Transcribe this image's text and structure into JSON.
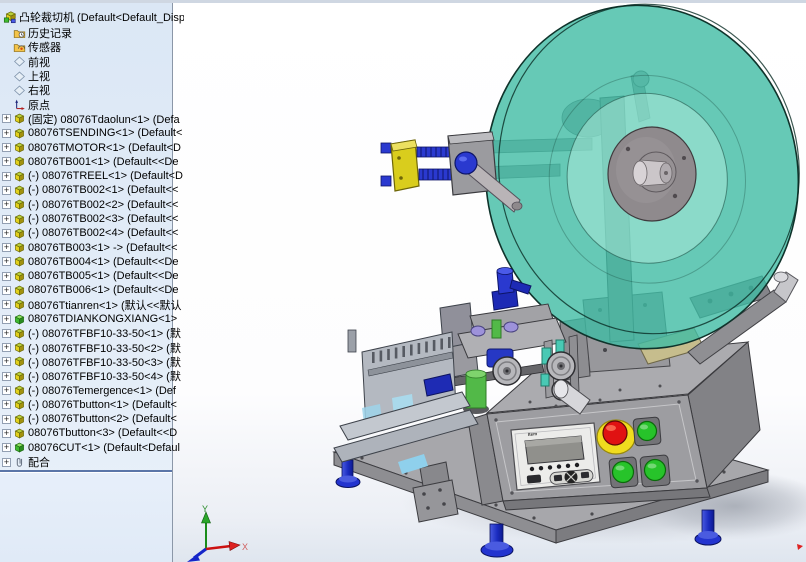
{
  "feature_tree": {
    "expander_glyph": "+",
    "root": {
      "icon": "assembly-icon",
      "label": "凸轮裁切机  (Default<Default_Displ"
    },
    "items": [
      {
        "icon": "history-folder-icon",
        "label": "历史记录",
        "expander": false
      },
      {
        "icon": "sensor-folder-icon",
        "label": "传感器",
        "expander": false
      },
      {
        "icon": "plane-icon",
        "label": "前视",
        "expander": false
      },
      {
        "icon": "plane-icon",
        "label": "上视",
        "expander": false
      },
      {
        "icon": "plane-icon",
        "label": "右视",
        "expander": false
      },
      {
        "icon": "origin-icon",
        "label": "原点",
        "expander": false
      },
      {
        "icon": "part-icon",
        "label": "(固定) 08076Tdaolun<1> (Defa",
        "expander": true
      },
      {
        "icon": "part-icon",
        "label": "08076TSENDING<1> (Default<",
        "expander": true
      },
      {
        "icon": "part-icon",
        "label": "08076TMOTOR<1> (Default<D",
        "expander": true
      },
      {
        "icon": "part-icon",
        "label": "08076TB001<1> (Default<<De",
        "expander": true
      },
      {
        "icon": "part-icon",
        "label": "(-) 08076TREEL<1> (Default<D",
        "expander": true
      },
      {
        "icon": "part-icon",
        "label": "(-) 08076TB002<1> (Default<<",
        "expander": true
      },
      {
        "icon": "part-icon",
        "label": "(-) 08076TB002<2> (Default<<",
        "expander": true
      },
      {
        "icon": "part-icon",
        "label": "(-) 08076TB002<3> (Default<<",
        "expander": true
      },
      {
        "icon": "part-icon",
        "label": "(-) 08076TB002<4> (Default<<",
        "expander": true
      },
      {
        "icon": "part-icon",
        "label": "08076TB003<1> -> (Default<<",
        "expander": true
      },
      {
        "icon": "part-icon",
        "label": "08076TB004<1> (Default<<De",
        "expander": true
      },
      {
        "icon": "part-icon",
        "label": "08076TB005<1> (Default<<De",
        "expander": true
      },
      {
        "icon": "part-icon",
        "label": "08076TB006<1> (Default<<De",
        "expander": true
      },
      {
        "icon": "part-icon",
        "label": "08076Ttianren<1> (默认<<默认",
        "expander": true
      },
      {
        "icon": "part-green-icon",
        "label": "08076TDIANKONGXIANG<1>",
        "expander": true
      },
      {
        "icon": "part-icon",
        "label": "(-) 08076TFBF10-33-50<1> (默",
        "expander": true
      },
      {
        "icon": "part-icon",
        "label": "(-) 08076TFBF10-33-50<2> (默",
        "expander": true
      },
      {
        "icon": "part-icon",
        "label": "(-) 08076TFBF10-33-50<3> (默",
        "expander": true
      },
      {
        "icon": "part-icon",
        "label": "(-) 08076TFBF10-33-50<4> (默",
        "expander": true
      },
      {
        "icon": "part-icon",
        "label": "(-) 08076Temergence<1> (Def",
        "expander": true
      },
      {
        "icon": "part-icon",
        "label": "(-) 08076Tbutton<1> (Default<",
        "expander": true
      },
      {
        "icon": "part-icon",
        "label": "(-) 08076Tbutton<2> (Default<",
        "expander": true
      },
      {
        "icon": "part-icon",
        "label": "08076Tbutton<3> (Default<<D",
        "expander": true
      },
      {
        "icon": "part-green-icon",
        "label": "08076CUT<1> (Default<Defaul",
        "expander": true
      },
      {
        "icon": "mates-icon",
        "label": "配合",
        "expander": true
      }
    ]
  },
  "viewport": {
    "triad": {
      "x_label": "X",
      "y_label": "Y"
    },
    "hmi": {
      "brand": "Item"
    }
  },
  "colors": {
    "panel_top": "#dbe7f5",
    "panel_bottom": "#e9f1fa",
    "disc": "rgba(64,187,164,0.8)",
    "disc_inner": "rgba(176,236,220,0.5)",
    "estop_red": "#e01212",
    "estop_yellow": "#f0dc1e",
    "btn_green": "#27c32a",
    "feet_blue": "#2334cf",
    "acc_yellow": "#d9cd1d",
    "acc_blue": "#2a39cf",
    "roller_green": "#52b948"
  }
}
